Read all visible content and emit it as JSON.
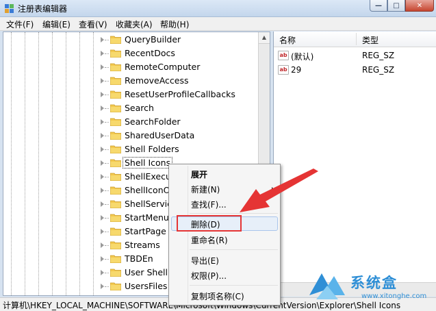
{
  "window": {
    "title": "注册表编辑器",
    "controls": {
      "minimize": "—",
      "maximize": "□",
      "close": "✕"
    }
  },
  "menu": [
    {
      "label": "文件(F)"
    },
    {
      "label": "编辑(E)"
    },
    {
      "label": "查看(V)"
    },
    {
      "label": "收藏夹(A)"
    },
    {
      "label": "帮助(H)"
    }
  ],
  "tree": {
    "items": [
      {
        "label": "QueryBuilder"
      },
      {
        "label": "RecentDocs"
      },
      {
        "label": "RemoteComputer"
      },
      {
        "label": "RemoveAccess"
      },
      {
        "label": "ResetUserProfileCallbacks"
      },
      {
        "label": "Search"
      },
      {
        "label": "SearchFolder"
      },
      {
        "label": "SharedUserData"
      },
      {
        "label": "Shell Folders"
      },
      {
        "label": "Shell Icons",
        "selected": true
      },
      {
        "label": "ShellExecut"
      },
      {
        "label": "ShellIconO"
      },
      {
        "label": "ShellService"
      },
      {
        "label": "StartMenu"
      },
      {
        "label": "StartPage"
      },
      {
        "label": "Streams"
      },
      {
        "label": "TBDEn"
      },
      {
        "label": "User Shell"
      },
      {
        "label": "UsersFiles"
      }
    ]
  },
  "values": {
    "headers": {
      "name": "名称",
      "type": "类型"
    },
    "rows": [
      {
        "name": "(默认)",
        "type": "REG_SZ",
        "icon": "ab"
      },
      {
        "name": "29",
        "type": "REG_SZ",
        "icon": "ab"
      }
    ]
  },
  "context_menu": {
    "items": [
      {
        "label": "展开",
        "bold": true
      },
      {
        "label": "新建(N)",
        "submenu": true
      },
      {
        "label": "查找(F)..."
      },
      {
        "label": "删除(D)",
        "highlighted": true
      },
      {
        "label": "重命名(R)"
      },
      {
        "label": "导出(E)"
      },
      {
        "label": "权限(P)..."
      },
      {
        "label": "复制项名称(C)"
      }
    ]
  },
  "status_bar": {
    "path": "计算机\\HKEY_LOCAL_MACHINE\\SOFTWARE\\Microsoft\\Windows\\CurrentVersion\\Explorer\\Shell Icons"
  },
  "watermark": {
    "title": "系统盒",
    "url": "www.xitonghe.com"
  },
  "colors": {
    "annotation_red": "#e53434",
    "highlight": "#e7eff9",
    "watermark_blue": "#2f8fd6"
  }
}
